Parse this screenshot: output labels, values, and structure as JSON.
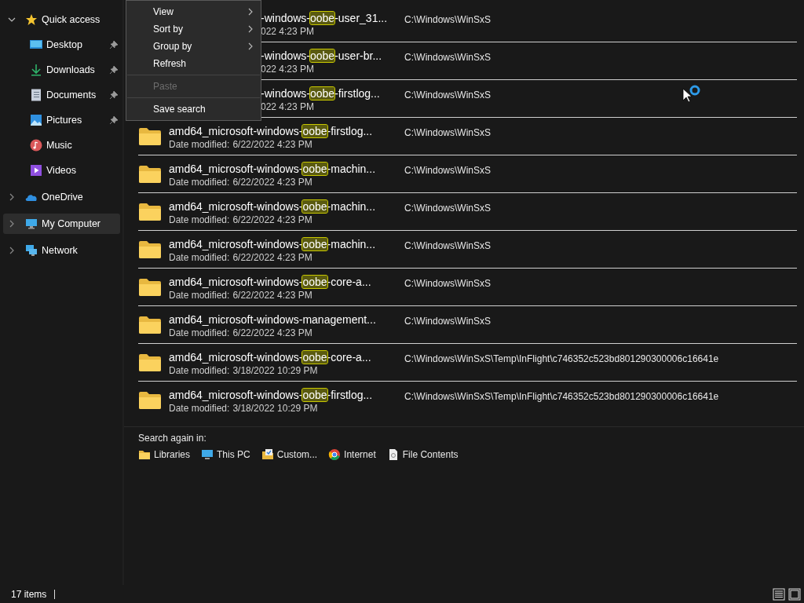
{
  "sidebar": {
    "items": [
      {
        "label": "Quick access",
        "kind": "star",
        "expanded": true,
        "selected": false,
        "children": [
          {
            "label": "Desktop",
            "kind": "desktop",
            "pinned": true,
            "selected": false
          },
          {
            "label": "Downloads",
            "kind": "download",
            "pinned": true,
            "selected": false
          },
          {
            "label": "Documents",
            "kind": "document",
            "pinned": true,
            "selected": false
          },
          {
            "label": "Pictures",
            "kind": "pictures",
            "pinned": true,
            "selected": false
          },
          {
            "label": "Music",
            "kind": "music",
            "pinned": false,
            "selected": false
          },
          {
            "label": "Videos",
            "kind": "videos",
            "pinned": false,
            "selected": false
          }
        ]
      },
      {
        "label": "OneDrive",
        "kind": "cloud",
        "expanded": false,
        "selected": false
      },
      {
        "label": "My Computer",
        "kind": "computer",
        "expanded": false,
        "selected": true
      },
      {
        "label": "Network",
        "kind": "network",
        "expanded": false,
        "selected": false
      }
    ]
  },
  "results": [
    {
      "covered": true,
      "name_before": "-windows-",
      "match": "oobe",
      "name_after": "-user_31...",
      "date": "022 4:23 PM",
      "location": "C:\\Windows\\WinSxS"
    },
    {
      "covered": true,
      "name_before": "-windows-",
      "match": "oobe",
      "name_after": "-user-br...",
      "date": "022 4:23 PM",
      "location": "C:\\Windows\\WinSxS"
    },
    {
      "covered": true,
      "name_before": "-windows-",
      "match": "oobe",
      "name_after": "-firstlog...",
      "date": "022 4:23 PM",
      "location": "C:\\Windows\\WinSxS"
    },
    {
      "covered": false,
      "name_before": "amd64_microsoft-windows-",
      "match": "oobe",
      "name_after": "-firstlog...",
      "date_label": "Date modified:",
      "date": "6/22/2022 4:23 PM",
      "location": "C:\\Windows\\WinSxS"
    },
    {
      "covered": false,
      "name_before": "amd64_microsoft-windows-",
      "match": "oobe",
      "name_after": "-machin...",
      "date_label": "Date modified:",
      "date": "6/22/2022 4:23 PM",
      "location": "C:\\Windows\\WinSxS"
    },
    {
      "covered": false,
      "name_before": "amd64_microsoft-windows-",
      "match": "oobe",
      "name_after": "-machin...",
      "date_label": "Date modified:",
      "date": "6/22/2022 4:23 PM",
      "location": "C:\\Windows\\WinSxS"
    },
    {
      "covered": false,
      "name_before": "amd64_microsoft-windows-",
      "match": "oobe",
      "name_after": "-machin...",
      "date_label": "Date modified:",
      "date": "6/22/2022 4:23 PM",
      "location": "C:\\Windows\\WinSxS"
    },
    {
      "covered": false,
      "name_before": "amd64_microsoft-windows-",
      "match": "oobe",
      "name_after": "-core-a...",
      "date_label": "Date modified:",
      "date": "6/22/2022 4:23 PM",
      "location": "C:\\Windows\\WinSxS"
    },
    {
      "covered": false,
      "name_before": "amd64_microsoft-windows-management...",
      "date_label": "Date modified:",
      "date": "6/22/2022 4:23 PM",
      "location": "C:\\Windows\\WinSxS"
    },
    {
      "covered": false,
      "name_before": "amd64_microsoft-windows-",
      "match": "oobe",
      "name_after": "-core-a...",
      "date_label": "Date modified:",
      "date": "3/18/2022 10:29 PM",
      "location": "C:\\Windows\\WinSxS\\Temp\\InFlight\\c746352c523bd801290300006c16641e"
    },
    {
      "covered": false,
      "name_before": "amd64_microsoft-windows-",
      "match": "oobe",
      "name_after": "-firstlog...",
      "date_label": "Date modified:",
      "date": "3/18/2022 10:29 PM",
      "location": "C:\\Windows\\WinSxS\\Temp\\InFlight\\c746352c523bd801290300006c16641e"
    }
  ],
  "search_again": {
    "label": "Search again in:",
    "options": [
      {
        "label": "Libraries",
        "kind": "folder"
      },
      {
        "label": "This PC",
        "kind": "computer"
      },
      {
        "label": "Custom...",
        "kind": "custom"
      },
      {
        "label": "Internet",
        "kind": "globe"
      },
      {
        "label": "File Contents",
        "kind": "file"
      }
    ]
  },
  "context_menu": {
    "items": [
      {
        "kind": "item",
        "label": "View",
        "submenu": true,
        "disabled": false
      },
      {
        "kind": "item",
        "label": "Sort by",
        "submenu": true,
        "disabled": false
      },
      {
        "kind": "item",
        "label": "Group by",
        "submenu": true,
        "disabled": false
      },
      {
        "kind": "item",
        "label": "Refresh",
        "submenu": false,
        "disabled": false
      },
      {
        "kind": "separator"
      },
      {
        "kind": "item",
        "label": "Paste",
        "submenu": false,
        "disabled": true
      },
      {
        "kind": "separator"
      },
      {
        "kind": "item",
        "label": "Save search",
        "submenu": false,
        "disabled": false
      }
    ]
  },
  "status_bar": {
    "count": "17 items"
  }
}
